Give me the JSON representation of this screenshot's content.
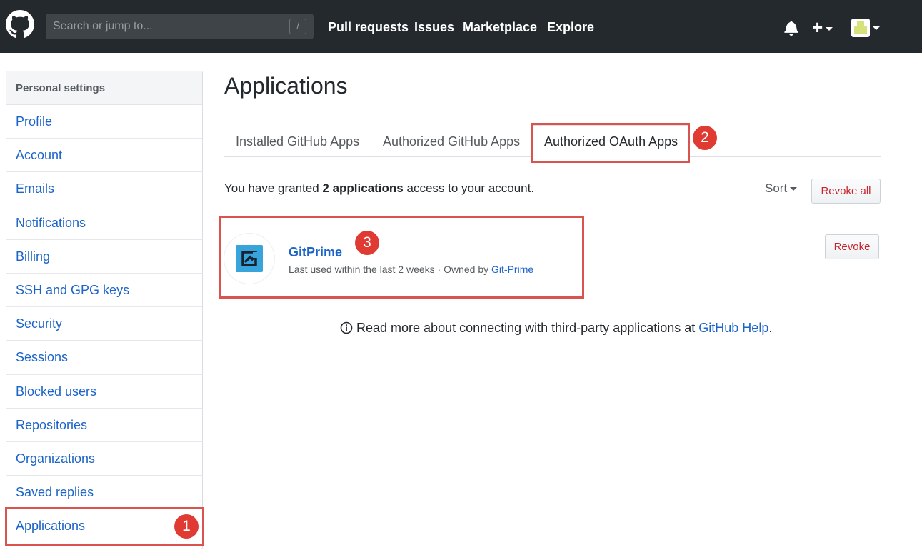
{
  "header": {
    "search_placeholder": "Search or jump to...",
    "search_shortcut": "/",
    "nav": [
      "Pull requests",
      "Issues",
      "Marketplace",
      "Explore"
    ],
    "plus_label": "+"
  },
  "sidebar": {
    "heading": "Personal settings",
    "items": [
      {
        "label": "Profile"
      },
      {
        "label": "Account"
      },
      {
        "label": "Emails"
      },
      {
        "label": "Notifications"
      },
      {
        "label": "Billing"
      },
      {
        "label": "SSH and GPG keys"
      },
      {
        "label": "Security"
      },
      {
        "label": "Sessions"
      },
      {
        "label": "Blocked users"
      },
      {
        "label": "Repositories"
      },
      {
        "label": "Organizations"
      },
      {
        "label": "Saved replies"
      },
      {
        "label": "Applications"
      }
    ]
  },
  "main": {
    "title": "Applications",
    "tabs": [
      {
        "label": "Installed GitHub Apps"
      },
      {
        "label": "Authorized GitHub Apps"
      },
      {
        "label": "Authorized OAuth Apps"
      }
    ],
    "summary_prefix": "You have granted ",
    "summary_count": "2 applications",
    "summary_suffix": " access to your account.",
    "sort_label": "Sort",
    "revoke_all_label": "Revoke all",
    "apps": [
      {
        "name": "GitPrime",
        "meta_prefix": "Last used within the last 2 weeks · Owned by ",
        "owner": "Git-Prime",
        "revoke_label": "Revoke"
      }
    ],
    "help_prefix": "Read more about connecting with third-party applications at ",
    "help_link": "GitHub Help",
    "help_suffix": "."
  },
  "annotations": {
    "badge_1": "1",
    "badge_2": "2",
    "badge_3": "3",
    "color": "#d9534f"
  },
  "colors": {
    "header_bg": "#24292e",
    "link": "#1d64c8",
    "danger": "#c6252e"
  }
}
